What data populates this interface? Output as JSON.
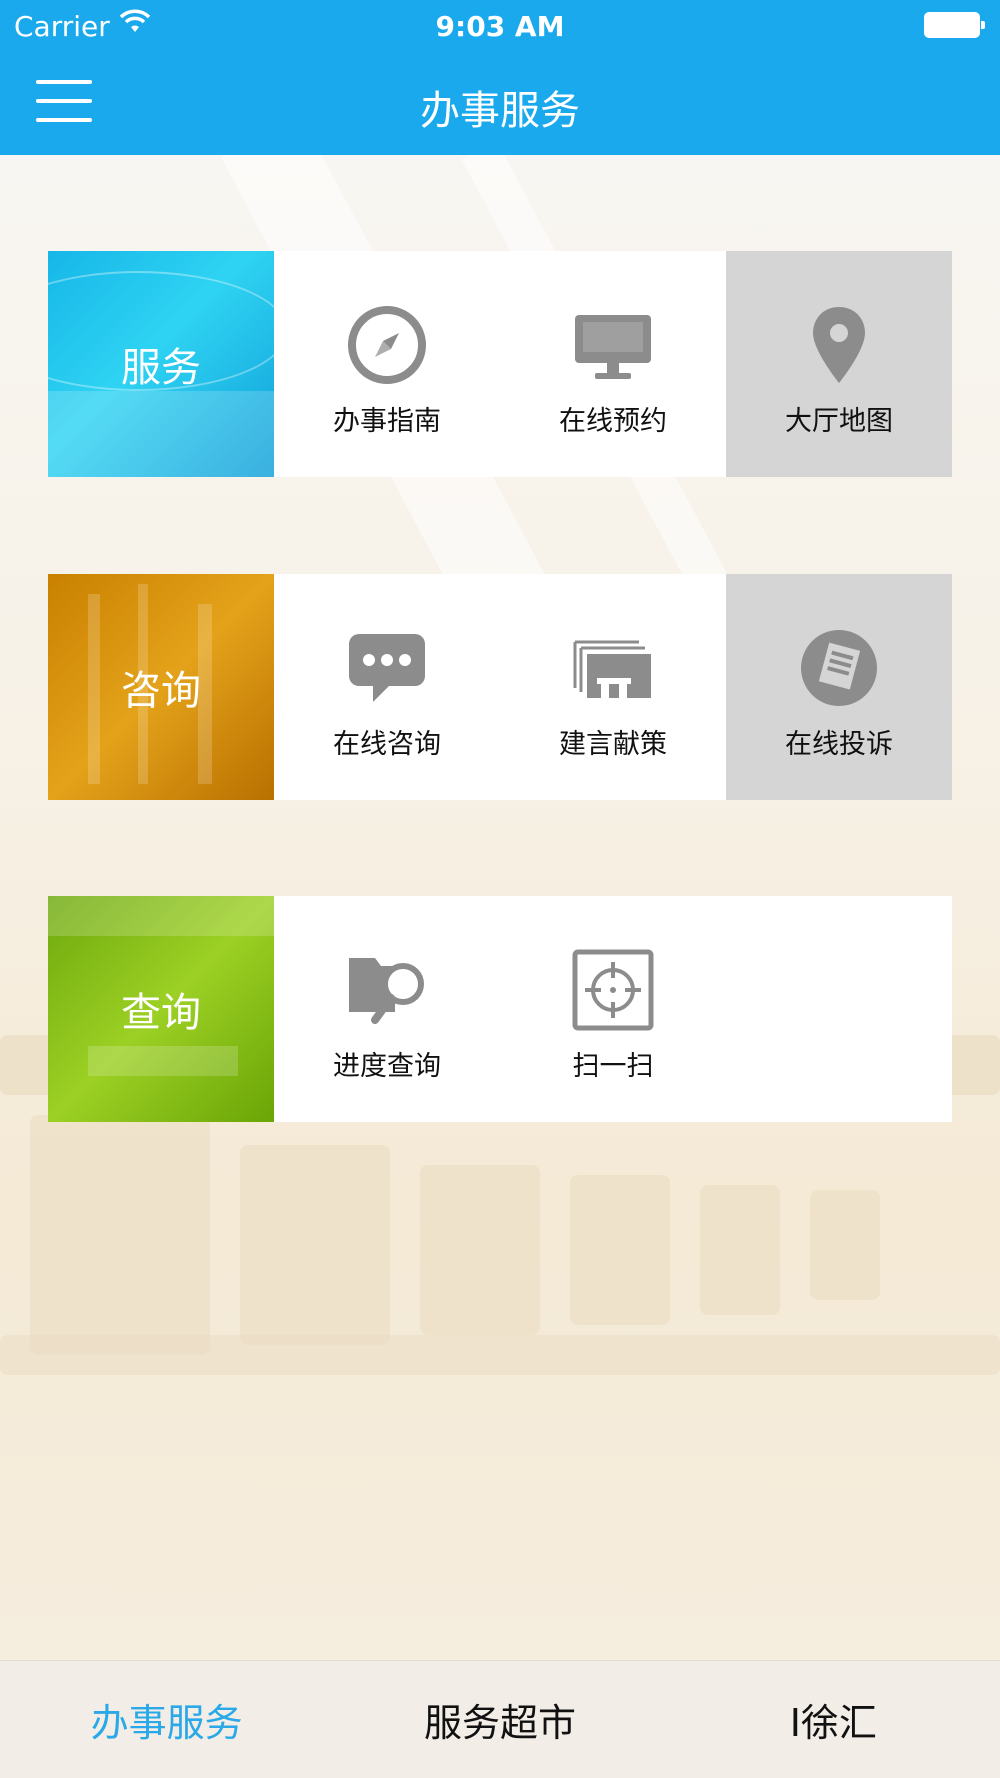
{
  "status_bar": {
    "carrier": "Carrier",
    "time": "9:03 AM"
  },
  "nav": {
    "title": "办事服务",
    "menu_icon": "hamburger-menu-icon"
  },
  "rows": [
    {
      "category": "服务",
      "items": [
        {
          "label": "办事指南",
          "icon": "compass-icon"
        },
        {
          "label": "在线预约",
          "icon": "monitor-icon"
        },
        {
          "label": "大厅地图",
          "icon": "map-pin-icon"
        }
      ]
    },
    {
      "category": "咨询",
      "items": [
        {
          "label": "在线咨询",
          "icon": "chat-bubble-icon"
        },
        {
          "label": "建言献策",
          "icon": "suggestion-cards-icon"
        },
        {
          "label": "在线投诉",
          "icon": "complaint-document-icon"
        }
      ]
    },
    {
      "category": "查询",
      "items": [
        {
          "label": "进度查询",
          "icon": "folder-search-icon"
        },
        {
          "label": "扫一扫",
          "icon": "scan-icon"
        }
      ]
    }
  ],
  "tabs": [
    {
      "label": "办事服务"
    },
    {
      "label": "服务超市"
    },
    {
      "label": "I徐汇"
    }
  ],
  "colors": {
    "accent": "#1aa9ed",
    "active_tab": "#2aa8e8",
    "icon_gray": "#8c8c8c"
  }
}
